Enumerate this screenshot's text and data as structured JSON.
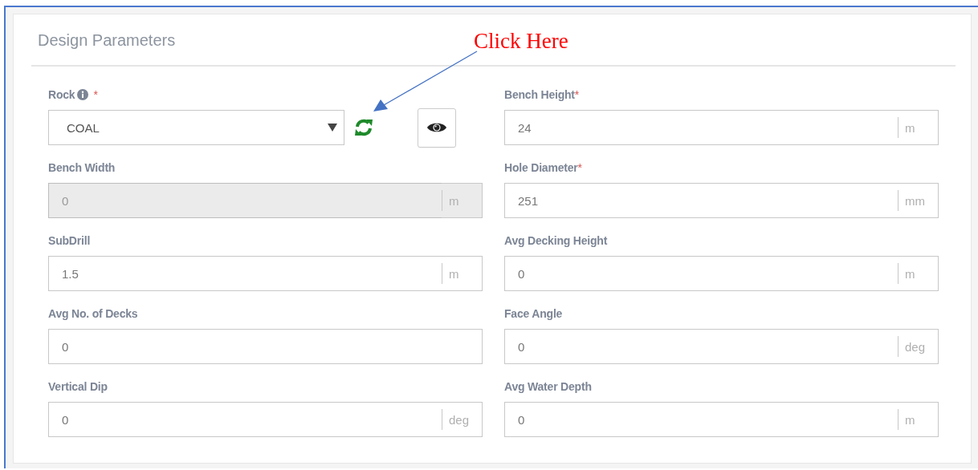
{
  "panel": {
    "title": "Design Parameters"
  },
  "annotation": {
    "text": "Click Here"
  },
  "fields": [
    {
      "kind": "select",
      "label": "Rock",
      "info": true,
      "required_mark": "*",
      "value": "COAL"
    },
    {
      "kind": "input",
      "label": "Bench Height",
      "required_mark": "*",
      "value": "24",
      "unit": "m",
      "disabled": false
    },
    {
      "kind": "input",
      "label": "Bench Width",
      "value": "0",
      "unit": "m",
      "disabled": true
    },
    {
      "kind": "input",
      "label": "Hole Diameter",
      "required_mark": "*",
      "value": "251",
      "unit": "mm",
      "disabled": false
    },
    {
      "kind": "input",
      "label": "SubDrill",
      "value": "1.5",
      "unit": "m",
      "disabled": false
    },
    {
      "kind": "input",
      "label": "Avg Decking Height",
      "value": "0",
      "unit": "m",
      "disabled": false
    },
    {
      "kind": "input",
      "label": "Avg No. of Decks",
      "value": "0",
      "disabled": false
    },
    {
      "kind": "input",
      "label": "Face Angle",
      "value": "0",
      "unit": "deg",
      "disabled": false
    },
    {
      "kind": "input",
      "label": "Vertical Dip",
      "value": "0",
      "unit": "deg",
      "disabled": false
    },
    {
      "kind": "input",
      "label": "Avg Water Depth",
      "value": "0",
      "unit": "m",
      "disabled": false
    }
  ]
}
